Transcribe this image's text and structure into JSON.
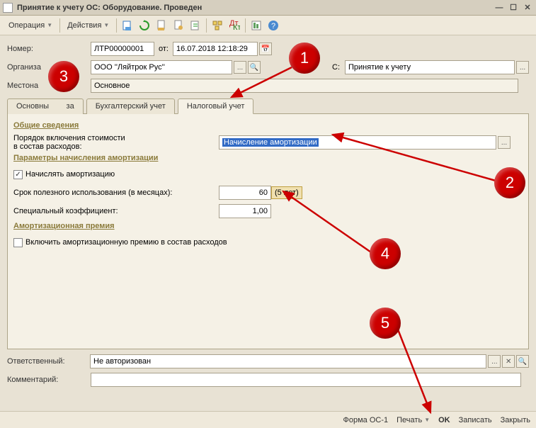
{
  "window": {
    "title": "Принятие к учету ОС: Оборудование. Проведен"
  },
  "toolbar": {
    "operation": "Операция",
    "actions": "Действия"
  },
  "fields": {
    "number_label": "Номер:",
    "number_value": "ЛТР00000001",
    "from_label": "от:",
    "date_value": "16.07.2018 12:18:29",
    "org_label": "Организа",
    "org_value": "ООО ''Ляйтрок Рус''",
    "event_label": "С:",
    "event_value": "Принятие к учету",
    "location_label": "Местона",
    "location_value": "Основное"
  },
  "tabs": {
    "t0": "Основны",
    "t0b": "за",
    "t1": "Бухгалтерский учет",
    "t2": "Налоговый учет"
  },
  "tax": {
    "grp1": "Общие сведения",
    "cost_label1": "Порядок включения стоимости",
    "cost_label2": "в состав расходов:",
    "cost_value": "Начисление амортизации",
    "grp2": "Параметры начисления амортизации",
    "calc_amort": "Начислять амортизацию",
    "useful_life_label": "Срок полезного использования (в месяцах):",
    "useful_life_value": "60",
    "useful_life_hint": "(5 лет)",
    "coeff_label": "Специальный коэффициент:",
    "coeff_value": "1,00",
    "grp3": "Амортизационная премия",
    "premium_label": "Включить амортизационную премию в состав расходов"
  },
  "bottom": {
    "resp_label": "Ответственный:",
    "resp_value": "Не авторизован",
    "comment_label": "Комментарий:"
  },
  "footer": {
    "form": "Форма ОС-1",
    "print": "Печать",
    "ok": "OK",
    "save": "Записать",
    "close": "Закрыть"
  },
  "callouts": {
    "c1": "1",
    "c2": "2",
    "c3": "3",
    "c4": "4",
    "c5": "5"
  }
}
